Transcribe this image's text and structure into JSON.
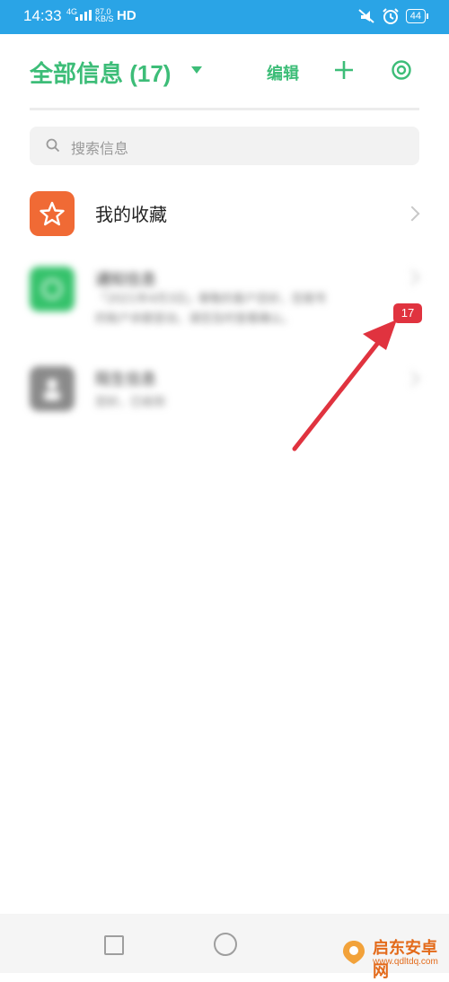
{
  "status_bar": {
    "time": "14:33",
    "network_line1": "4G",
    "network_line2": "KB/S",
    "speed": "87.0",
    "hd": "HD",
    "battery": "44"
  },
  "header": {
    "title": "全部信息 (17)",
    "edit_label": "编辑"
  },
  "search": {
    "placeholder": "搜索信息"
  },
  "list": {
    "favorites_label": "我的收藏",
    "notification_label": "通知信息",
    "notification_snippet_1": "「2021年4月3日」尊敬的客户您好，您尾号",
    "notification_snippet_2": "的账户余额变动，请您及时查看确认。",
    "other_label": "陌生信息",
    "other_snippet": "您好，已收到"
  },
  "badge": {
    "count": "17"
  },
  "watermark": {
    "name": "启东安卓网",
    "url": "www.qdltdq.com"
  },
  "colors": {
    "accent": "#3dbd78",
    "status_bar": "#2aa4e6",
    "badge": "#e0333f",
    "favorites_icon": "#f06a35",
    "arrow": "#e0333f"
  }
}
